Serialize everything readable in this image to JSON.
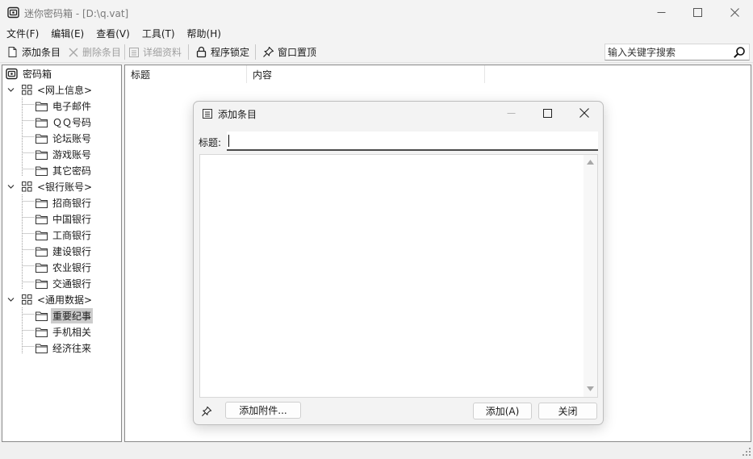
{
  "window": {
    "title": "迷你密码箱 - [D:\\q.vat]"
  },
  "menu": [
    "文件(F)",
    "编辑(E)",
    "查看(V)",
    "工具(T)",
    "帮助(H)"
  ],
  "toolbar": {
    "add_label": "添加条目",
    "delete_label": "删除条目",
    "details_label": "详细资料",
    "lock_label": "程序锁定",
    "topmost_label": "窗口置顶",
    "search_placeholder": "输入关键字搜索"
  },
  "tree": {
    "root": "密码箱",
    "groups": [
      {
        "label": "<网上信息>",
        "items": [
          "电子邮件",
          "ＱＱ号码",
          "论坛账号",
          "游戏账号",
          "其它密码"
        ]
      },
      {
        "label": "<银行账号>",
        "items": [
          "招商银行",
          "中国银行",
          "工商银行",
          "建设银行",
          "农业银行",
          "交通银行"
        ]
      },
      {
        "label": "<通用数据>",
        "items": [
          "重要纪事",
          "手机相关",
          "经济往来"
        ]
      }
    ],
    "selected": "重要纪事"
  },
  "list": {
    "columns": [
      "标题",
      "内容"
    ]
  },
  "dialog": {
    "title": "添加条目",
    "field_label": "标题:",
    "title_value": "",
    "content_value": "",
    "attach_label": "添加附件...",
    "add_label": "添加(A)",
    "close_label": "关闭"
  }
}
